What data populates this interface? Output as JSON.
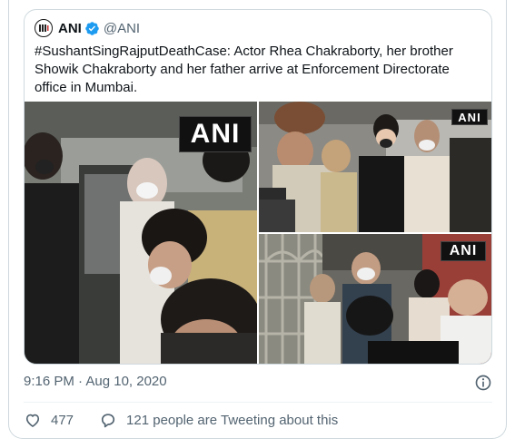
{
  "quoted_tweet": {
    "author_name": "ANI",
    "handle": "@ANI",
    "verified": true,
    "text": "#SushantSingRajputDeathCase: Actor Rhea Chakraborty, her brother Showik Chakraborty and her father arrive at Enforcement Directorate office in Mumbai.",
    "media": [
      {
        "watermark": "ANI"
      },
      {
        "watermark": "ANI"
      },
      {
        "watermark": "ANI"
      }
    ]
  },
  "meta": {
    "timestamp": "9:16 PM · Aug 10, 2020",
    "info_icon": "info-icon"
  },
  "actions": {
    "like_count": "477",
    "conversation_label": "121 people are Tweeting about this"
  },
  "colors": {
    "accent": "#1d9bf0",
    "muted": "#536471",
    "border": "#cfd9de",
    "like_hover": "#f91880"
  }
}
